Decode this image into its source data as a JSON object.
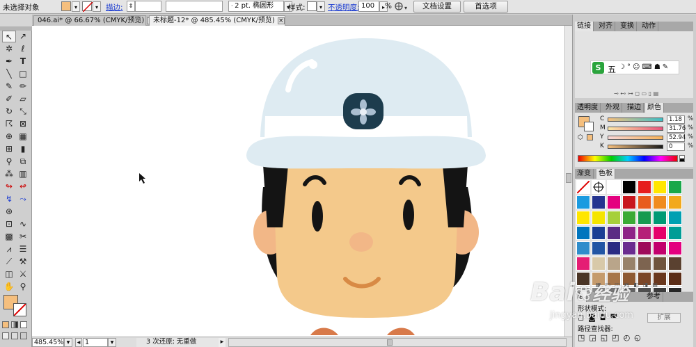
{
  "controlbar": {
    "selection_label": "未选择对象",
    "stroke_link": "描边:",
    "stroke_value": "",
    "brush_value": "2 pt. 椭圆形",
    "style_label": "样式:",
    "opacity_link": "不透明度:",
    "opacity_value": "100",
    "opacity_unit": "%",
    "doc_setup_button": "文档设置",
    "preferences_button": "首选项",
    "fill_color": "#f5bf7e"
  },
  "tabs": [
    {
      "label": "046.ai* @ 66.67% (CMYK/预览)",
      "close": "×"
    },
    {
      "label": "未标题-12* @ 485.45% (CMYK/预览)",
      "close": "×"
    }
  ],
  "status": {
    "zoom": "485.45%",
    "page": "1",
    "message": "3 次还原; 无重做"
  },
  "panels": {
    "top_tabs": [
      "链接",
      "对齐",
      "变换",
      "动作"
    ],
    "ime_logo": "S",
    "ime_label": "五",
    "color_tabs": [
      "透明度",
      "外观",
      "描边",
      "颜色"
    ],
    "cmyk": [
      {
        "key": "C",
        "value": "1.18",
        "unit": "%"
      },
      {
        "key": "M",
        "value": "31.76",
        "unit": "%"
      },
      {
        "key": "Y",
        "value": "52.94",
        "unit": "%"
      },
      {
        "key": "K",
        "value": "0",
        "unit": "%"
      }
    ],
    "swatch_tabs": [
      "渐变",
      "色板"
    ],
    "bottom_tabs": [
      "路",
      "参考"
    ],
    "bottom_text1": "形状模式:",
    "bottom_text2": "路径查找器:",
    "expand_button": "扩展",
    "swatch_colors": [
      "#ffffff",
      "#ffffff",
      "#ffffff",
      "#000000",
      "#e61e1e",
      "#ffe600",
      "#19a84a",
      "#1b9be0",
      "#24338f",
      "#e4007f",
      "#c8161d",
      "#e85c1e",
      "#f08c1e",
      "#f2a91c",
      "#ffe600",
      "#f5e500",
      "#a6d03a",
      "#3aaa35",
      "#169a50",
      "#009a74",
      "#00a0b2",
      "#0075be",
      "#1c3e94",
      "#5b2b84",
      "#8e2487",
      "#b51f78",
      "#e5006a",
      "#009d96",
      "#2f8dcb",
      "#2255a4",
      "#2b2c83",
      "#6a2c8f",
      "#9e0b5a",
      "#c2006d",
      "#e3007f",
      "#e51d74",
      "#d8c9a9",
      "#b9a58a",
      "#98826a",
      "#7d6450",
      "#6f543d",
      "#5a4130",
      "#4a3526",
      "#c59b6d",
      "#a7764a",
      "#8e5a33",
      "#7b4627",
      "#6a381e",
      "#5b2d17",
      "#9e9e9e",
      "#8a8a8a",
      "#767676",
      "#626262",
      "#4e4e4e",
      "#3a3a3a",
      "#262626"
    ]
  },
  "watermark": {
    "brand": "Bai",
    "jingyan": "经验",
    "url": "jingyan.baidu.com"
  }
}
